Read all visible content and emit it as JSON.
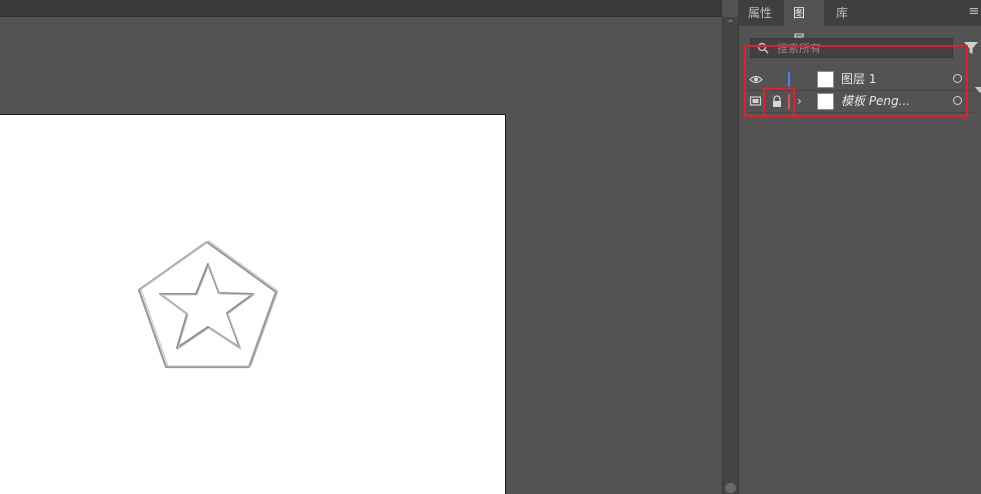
{
  "panel": {
    "tabs": [
      {
        "label": "属性"
      },
      {
        "label": "图层"
      },
      {
        "label": "库"
      }
    ],
    "active_tab": "图层",
    "search": {
      "placeholder": "搜索所有"
    },
    "layers": [
      {
        "name": "图层 1",
        "visible": true,
        "locked": false,
        "color": "#4f7cff",
        "expandable": false
      },
      {
        "name": "模板 Peng...",
        "visible": true,
        "template": true,
        "locked": true,
        "color": "#e05050",
        "expandable": true
      }
    ]
  },
  "canvas": {
    "artwork": "pentagon-star-sketch"
  },
  "icons": {
    "search": "search-icon",
    "filter": "filter-icon",
    "menu": "panel-menu-icon",
    "eye": "eye-icon",
    "template": "template-icon",
    "lock": "lock-icon",
    "chevron": "chevron-right-icon",
    "target": "target-circle-icon"
  },
  "colors": {
    "highlight": "#e0202a",
    "panel_bg": "#535353"
  }
}
